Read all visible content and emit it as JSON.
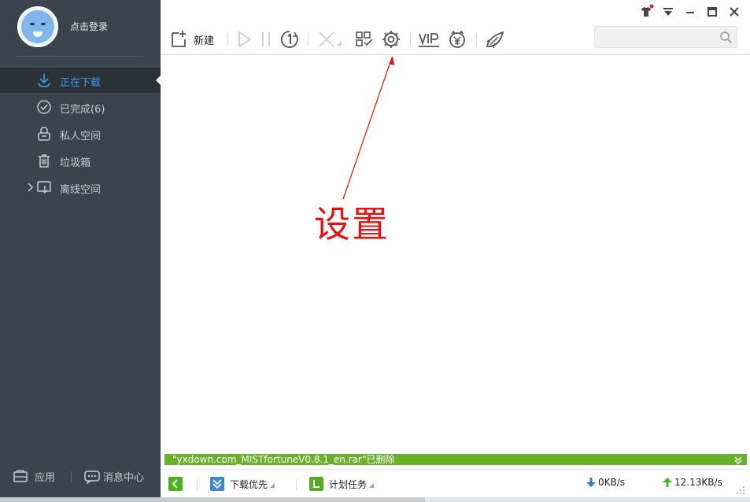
{
  "sidebar": {
    "login_text": "点击登录",
    "nav": [
      {
        "label": "正在下载",
        "icon": "download-icon",
        "active": true
      },
      {
        "label": "已完成(6)",
        "icon": "check-circle-icon",
        "active": false
      },
      {
        "label": "私人空间",
        "icon": "lock-icon",
        "active": false
      },
      {
        "label": "垃圾箱",
        "icon": "trash-icon",
        "active": false
      },
      {
        "label": "离线空间",
        "icon": "cloud-download-icon",
        "active": false
      }
    ],
    "bottom": {
      "apps_label": "应用",
      "messages_label": "消息中心"
    }
  },
  "toolbar": {
    "new_label": "新建",
    "search_placeholder": ""
  },
  "annotation": {
    "text": "设置",
    "color": "#e01414"
  },
  "notification": {
    "text": "\"yxdown.com_MISTfortuneV0.8.1_en.rar\"已删除",
    "color": "#6ab12a"
  },
  "statusbar": {
    "priority_label": "下载优先",
    "schedule_label": "计划任务",
    "download_speed": "0KB/s",
    "upload_speed": "12.13KB/s"
  },
  "colors": {
    "sidebar_bg": "#3b444c",
    "active_text": "#3d9de8",
    "accent_green": "#6ab12a"
  }
}
